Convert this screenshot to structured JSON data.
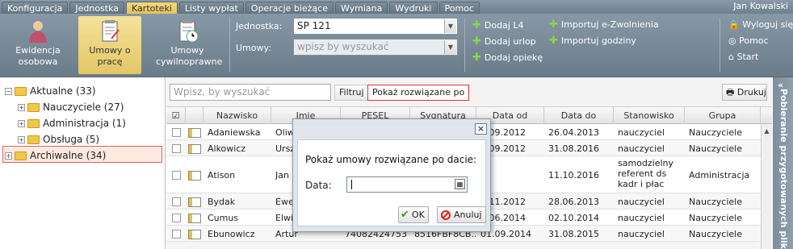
{
  "menu": {
    "tabs": [
      "Konfiguracja",
      "Jednostka",
      "Kartoteki",
      "Listy wypłat",
      "Operacje bieżące",
      "Wymiana",
      "Wydruki",
      "Pomoc"
    ],
    "active": "Kartoteki",
    "user": "Jan Kowalski"
  },
  "ribbon": {
    "big_buttons": [
      "Ewidencja osobowa",
      "Umowy o pracę",
      "Umowy cywilnoprawne"
    ],
    "jednostka_label": "Jednostka:",
    "jednostka_value": "SP 121",
    "umowy_label": "Umowy:",
    "umowy_placeholder": "wpisz by wyszukać",
    "actions": [
      "Dodaj L4",
      "Dodaj urlop",
      "Dodaj opiekę",
      "Importuj e-Zwolnienia",
      "Importuj godziny"
    ],
    "right": [
      "Wyloguj się",
      "Pomoc",
      "Start"
    ]
  },
  "tree": {
    "items": [
      {
        "label": "Aktualne (33)",
        "level": 0
      },
      {
        "label": "Nauczyciele (27)",
        "level": 1
      },
      {
        "label": "Administracja (1)",
        "level": 1
      },
      {
        "label": "Obsługa (5)",
        "level": 1
      },
      {
        "label": "Archiwalne (34)",
        "level": 0
      }
    ]
  },
  "toolbar": {
    "search_placeholder": "Wpisz, by wyszukać",
    "filtruj": "Filtruj",
    "pokaz": "Pokaż rozwiązane po",
    "drukuj": "Drukuj"
  },
  "grid": {
    "columns": [
      "Nazwisko",
      "Imię",
      "PESEL",
      "Sygnatura",
      "Data od",
      "Data do",
      "Stanowisko",
      "Grupa"
    ],
    "rows": [
      [
        "Adaniewska",
        "Oliw",
        "",
        "",
        "1.09.2012",
        "26.04.2013",
        "nauczyciel",
        "Nauczyciele"
      ],
      [
        "Alkowicz",
        "Ursz",
        "",
        "",
        "1.09.2012",
        "31.08.2016",
        "nauczyciel",
        "Nauczyciele"
      ],
      [
        "Atison",
        "Jan",
        "",
        "",
        "",
        "11.10.2016",
        "samodzielny referent ds kadr i płac",
        "Administracja"
      ],
      [
        "Bydak",
        "Ewe",
        "",
        "",
        "1.11.2012",
        "28.06.2013",
        "nauczyciel",
        "Nauczyciele"
      ],
      [
        "Cumus",
        "Elwi",
        "",
        "",
        "1.06.2014",
        "02.10.2014",
        "nauczyciel",
        "Nauczyciele"
      ],
      [
        "Ebunowicz",
        "Artur",
        "74082424753",
        "8516FBF8CB...",
        "01.09.2014",
        "31.08.2015",
        "nauczyciel",
        "Nauczyciele"
      ]
    ]
  },
  "side_panel": "Pobieranie przygotowanych plików",
  "modal": {
    "close": "×",
    "message": "Pokaż umowy rozwiązane po dacie:",
    "date_label": "Data:",
    "date_value": "",
    "ok": "OK",
    "cancel": "Anuluj"
  }
}
